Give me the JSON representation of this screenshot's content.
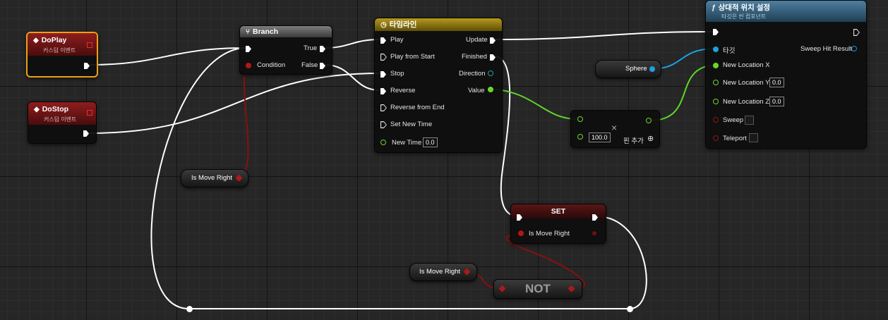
{
  "nodes": {
    "doplay": {
      "title": "DoPlay",
      "subtitle": "커스텀 이벤트"
    },
    "dostop": {
      "title": "DoStop",
      "subtitle": "커스텀 이벤트"
    },
    "branch": {
      "title": "Branch",
      "condition": "Condition",
      "true_label": "True",
      "false_label": "False"
    },
    "timeline": {
      "title": "타임라인",
      "inputs": [
        "Play",
        "Play from Start",
        "Stop",
        "Reverse",
        "Reverse from End",
        "Set New Time"
      ],
      "new_time_label": "New Time",
      "new_time_value": "0.0",
      "outputs": [
        "Update",
        "Finished",
        "Direction",
        "Value"
      ]
    },
    "set_relative": {
      "title": "상대적 위치 설정",
      "subtitle": "타깃은 씬 컴포넌트",
      "target_label": "타깃",
      "sweep_hit_result": "Sweep Hit Result",
      "new_location_x": "New Location X",
      "new_location_y": "New Location Y",
      "new_location_y_value": "0.0",
      "new_location_z": "New Location Z",
      "new_location_z_value": "0.0",
      "sweep": "Sweep",
      "teleport": "Teleport"
    },
    "multiply": {
      "operand_value": "100.0",
      "add_pin": "핀 추가",
      "symbol": "×"
    },
    "sphere": {
      "label": "Sphere"
    },
    "is_move_right_1": {
      "label": "Is Move Right"
    },
    "set_node": {
      "title": "SET",
      "var_label": "Is Move Right"
    },
    "is_move_right_2": {
      "label": "Is Move Right"
    },
    "not_node": {
      "label": "NOT"
    }
  },
  "colors": {
    "exec_wire": "#ffffff",
    "bool_wire": "#8a1010",
    "float_wire": "#5ed62a",
    "object_wire": "#1ea0e0",
    "selected_outline": "#f0a014"
  },
  "icons": {
    "event": "event-diamond-icon",
    "branch": "branch-icon",
    "timeline": "clock-icon",
    "function": "function-icon"
  }
}
